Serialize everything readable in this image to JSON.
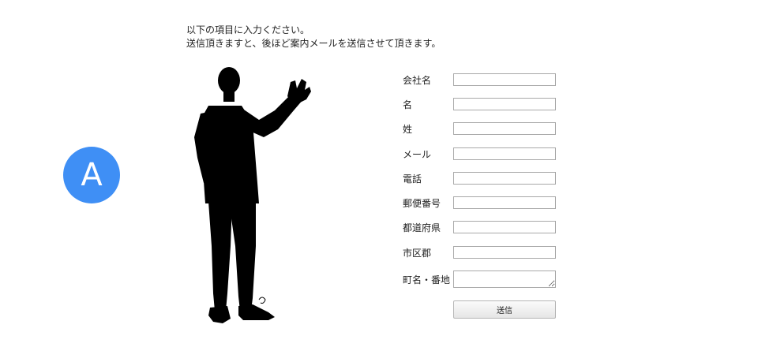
{
  "intro": {
    "line1": "以下の項目に入力ください。",
    "line2": "送信頂きますと、後ほど案内メールを送信させて頂きます。"
  },
  "badge": {
    "letter": "A",
    "color": "#3f8ff5"
  },
  "form": {
    "fields": [
      {
        "label": "会社名",
        "value": ""
      },
      {
        "label": "名",
        "value": ""
      },
      {
        "label": "姓",
        "value": ""
      },
      {
        "label": "メール",
        "value": ""
      },
      {
        "label": "電話",
        "value": ""
      },
      {
        "label": "郵便番号",
        "value": ""
      },
      {
        "label": "都道府県",
        "value": ""
      },
      {
        "label": "市区郡",
        "value": ""
      },
      {
        "label": "町名・番地",
        "value": ""
      }
    ],
    "submit_label": "送信"
  }
}
